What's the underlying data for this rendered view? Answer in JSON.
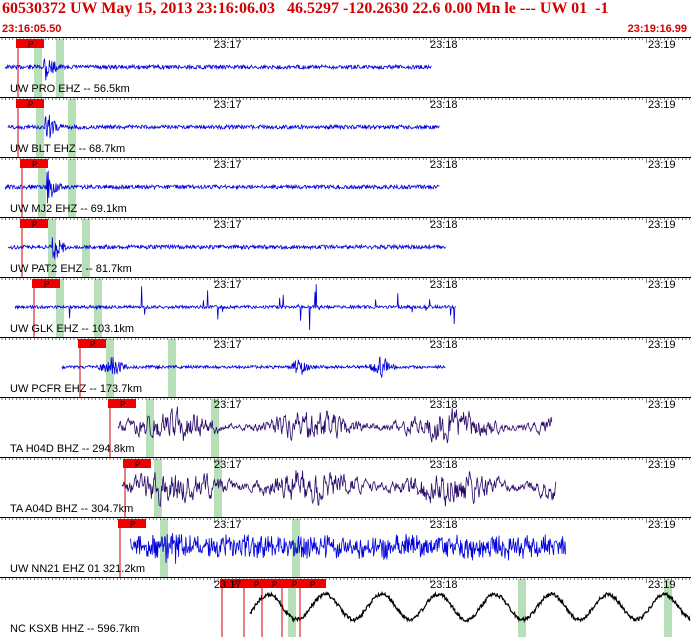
{
  "header": {
    "title": "60530372 UW May 15, 2013 23:16:06.03   46.5297 -120.2630 22.6 0.00 Mn le --- UW 01  -1",
    "start_time": "23:16:05.50",
    "end_time": "23:19:16.99",
    "text_color": "#d40000"
  },
  "time_ticks": [
    "23:17",
    "23:18",
    "23:19"
  ],
  "pick_label": "P",
  "traces": [
    {
      "label": "UW PRO  EHZ -- 56.5km",
      "color": "#0000dd",
      "style": "quake",
      "amp": 5
    },
    {
      "label": "UW BLT  EHZ -- 68.7km",
      "color": "#0000dd",
      "style": "quake",
      "amp": 7
    },
    {
      "label": "UW MJ2  EHZ -- 69.1km",
      "color": "#0000dd",
      "style": "quake",
      "amp": 5
    },
    {
      "label": "UW PAT2 EHZ -- 81.7km",
      "color": "#0000dd",
      "style": "quake",
      "amp": 5
    },
    {
      "label": "UW GLK  EHZ -- 103.1km",
      "color": "#0000dd",
      "style": "spikes",
      "amp": 2
    },
    {
      "label": "UW PCFR EHZ -- 173.7km",
      "color": "#0000dd",
      "style": "bursts",
      "amp": 3
    },
    {
      "label": "TA H04D BHZ -- 294.8km",
      "color": "#2a0a6a",
      "style": "noisy",
      "amp": 12
    },
    {
      "label": "TA A04D BHZ -- 304.7km",
      "color": "#2a0a6a",
      "style": "noisy",
      "amp": 14
    },
    {
      "label": "UW NN21 EHZ 01 321.2km",
      "color": "#0000dd",
      "style": "dense",
      "amp": 10
    },
    {
      "label": "NC KSXB HHZ -- 596.7km",
      "color": "#000000",
      "style": "wave",
      "amp": 18
    }
  ]
}
